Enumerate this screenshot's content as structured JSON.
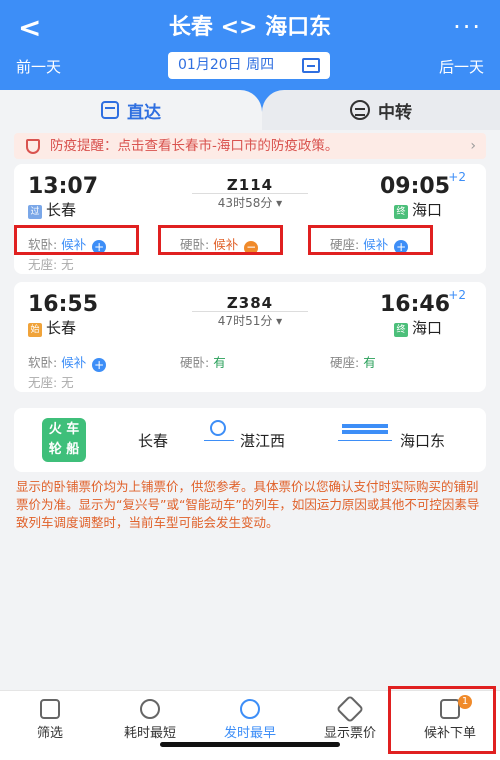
{
  "header": {
    "back_icon": "chevron-left-icon",
    "title": "长春 <> 海口东",
    "more": "···",
    "prev_day": "前一天",
    "next_day": "后一天",
    "date": "01月20日 周四"
  },
  "tabs": [
    {
      "label": "直达",
      "active": true
    },
    {
      "label": "中转",
      "active": false
    }
  ],
  "notice": {
    "text": "防疫提醒：点击查看长春市-海口市的防疫政策。",
    "arrow": "›"
  },
  "trains": [
    {
      "dep_time": "13:07",
      "arr_time": "09:05",
      "plus_day": "+2",
      "train_no": "Z114",
      "duration": "43时58分 ▾",
      "dep_badge": "过",
      "dep_station": "长春",
      "arr_badge": "终",
      "arr_station": "海口",
      "seats": [
        {
          "label": "软卧:",
          "value": "候补",
          "icon": "plus"
        },
        {
          "label": "硬卧:",
          "value": "候补",
          "icon": "minus"
        },
        {
          "label": "硬座:",
          "value": "候补",
          "icon": "plus"
        }
      ],
      "no_seat": "无座: 无"
    },
    {
      "dep_time": "16:55",
      "arr_time": "16:46",
      "plus_day": "+2",
      "train_no": "Z384",
      "duration": "47时51分 ▾",
      "dep_badge": "始",
      "dep_station": "长春",
      "arr_badge": "终",
      "arr_station": "海口",
      "seats": [
        {
          "label": "软卧:",
          "value": "候补",
          "icon": "plus"
        },
        {
          "label": "硬卧:",
          "value": "有"
        },
        {
          "label": "硬座:",
          "value": "有"
        }
      ],
      "no_seat": "无座: 无"
    }
  ],
  "multimodal": {
    "logo_line1": "火 车",
    "logo_line2": "轮 船",
    "stop1": "长春",
    "stop2": "湛江西",
    "stop3": "海口东"
  },
  "disclaimer": "显示的卧铺票价均为上铺票价，供您参考。具体票价以您确认支付时实际购买的铺别票价为准。显示为“复兴号”或“智能动车”的列车，如因运力原因或其他不可控因素导致列车调度调整时，当前车型可能会发生变动。",
  "bottom_bar": [
    {
      "label": "筛选",
      "icon": "filter-icon"
    },
    {
      "label": "耗时最短",
      "icon": "timer-icon"
    },
    {
      "label": "发时最早",
      "icon": "clock-icon",
      "active": true
    },
    {
      "label": "显示票价",
      "icon": "price-tag-icon"
    },
    {
      "label": "候补下单",
      "icon": "cart-icon",
      "badge": "1"
    }
  ],
  "colors": {
    "header": "#3d8ef7",
    "notice_text": "#d9534f",
    "highlight_box": "#e02020"
  }
}
